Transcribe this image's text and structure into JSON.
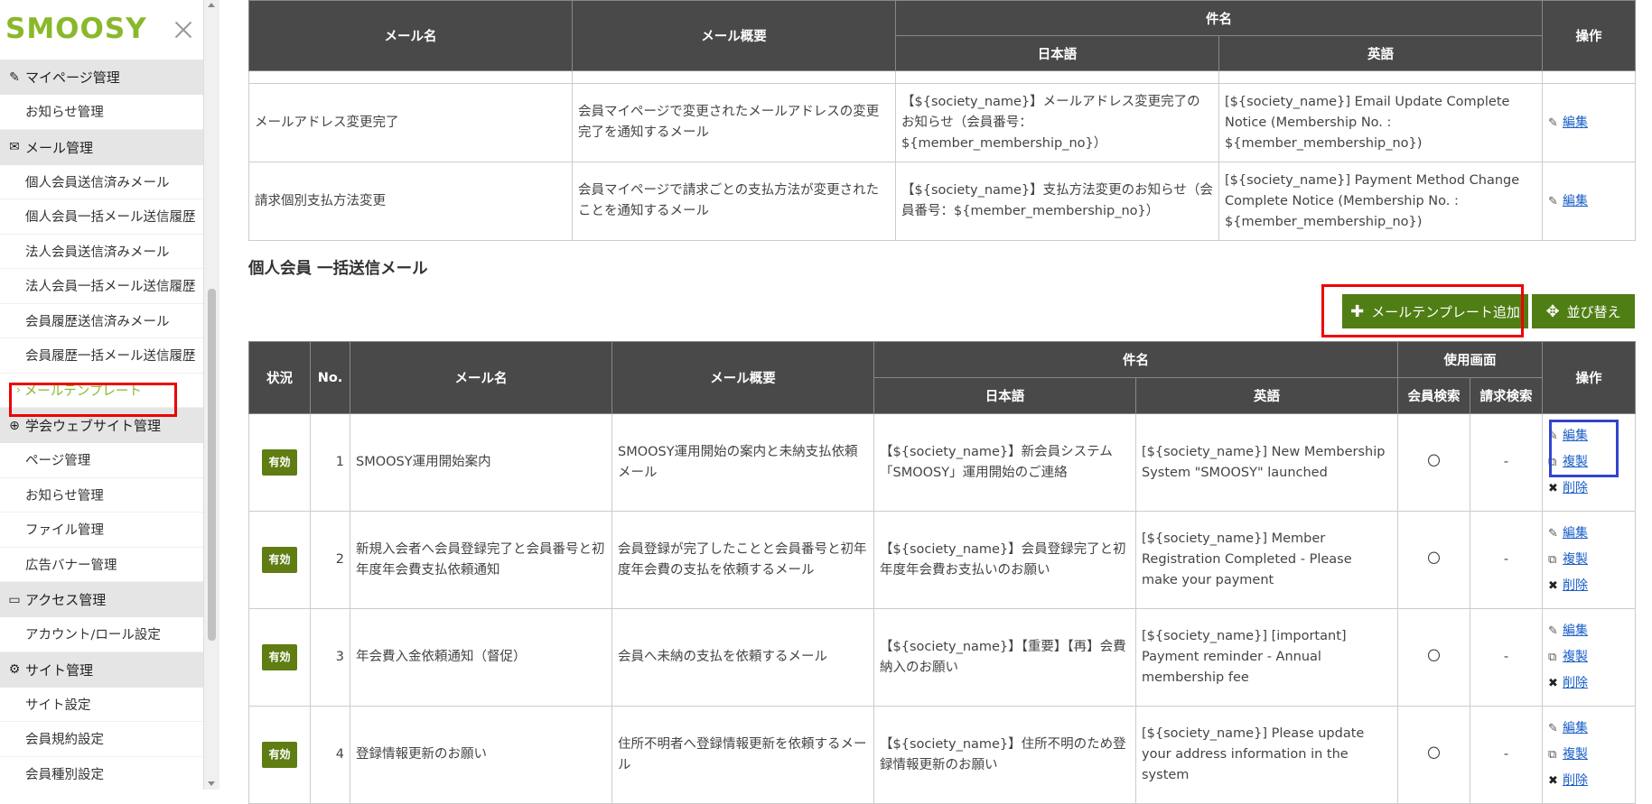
{
  "sidebar": {
    "logo": "SMOOSY",
    "groups": [
      {
        "icon": "pencil-icon",
        "label": "マイページ管理",
        "items": [
          "お知らせ管理"
        ]
      },
      {
        "icon": "mail-icon",
        "label": "メール管理",
        "items": [
          "個人会員送信済みメール",
          "個人会員一括メール送信履歴",
          "法人会員送信済みメール",
          "法人会員一括メール送信履歴",
          "会員履歴送信済みメール",
          "会員履歴一括メール送信履歴",
          "メールテンプレート"
        ]
      },
      {
        "icon": "globe-icon",
        "label": "学会ウェブサイト管理",
        "items": [
          "ページ管理",
          "お知らせ管理",
          "ファイル管理",
          "広告バナー管理"
        ]
      },
      {
        "icon": "monitor-icon",
        "label": "アクセス管理",
        "items": [
          "アカウント/ロール設定"
        ]
      },
      {
        "icon": "gear-icon",
        "label": "サイト管理",
        "items": [
          "サイト設定",
          "会員規約設定",
          "会員種別設定"
        ]
      }
    ]
  },
  "table1": {
    "headers": {
      "mail_name": "メール名",
      "summary": "メール概要",
      "subject": "件名",
      "ja": "日本語",
      "en": "英語",
      "ops": "操作"
    },
    "rows": [
      {
        "name": "メールアドレス変更完了",
        "summary": "会員マイページで変更されたメールアドレスの変更完了を通知するメール",
        "ja": "【${society_name}】メールアドレス変更完了のお知らせ（会員番号：${member_membership_no}）",
        "en": "[${society_name}] Email Update Complete Notice (Membership No. : ${member_membership_no})",
        "edit": "編集"
      },
      {
        "name": "請求個別支払方法変更",
        "summary": "会員マイページで請求ごとの支払方法が変更されたことを通知するメール",
        "ja": "【${society_name}】支払方法変更のお知らせ（会員番号：${member_membership_no}）",
        "en": "[${society_name}] Payment Method Change Complete Notice (Membership No. : ${member_membership_no})",
        "edit": "編集"
      }
    ]
  },
  "section2": {
    "title": "個人会員 一括送信メール",
    "add_button": "メールテンプレート追加",
    "sort_button": "並び替え"
  },
  "table2": {
    "headers": {
      "status": "状況",
      "no": "No.",
      "mail_name": "メール名",
      "summary": "メール概要",
      "subject": "件名",
      "ja": "日本語",
      "en": "英語",
      "screen": "使用画面",
      "member_search": "会員検索",
      "billing_search": "請求検索",
      "ops": "操作"
    },
    "rows": [
      {
        "status": "有効",
        "no": "1",
        "name": "SMOOSY運用開始案内",
        "summary": "SMOOSY運用開始の案内と未納支払依頼メール",
        "ja": "【${society_name}】新会員システム「SMOOSY」運用開始のご連絡",
        "en": "[${society_name}] New Membership System \"SMOOSY\" launched",
        "member": "〇",
        "billing": "-",
        "edit": "編集",
        "copy": "複製",
        "delete": "削除"
      },
      {
        "status": "有効",
        "no": "2",
        "name": "新規入会者へ会員登録完了と会員番号と初年度年会費支払依頼通知",
        "summary": "会員登録が完了したことと会員番号と初年度年会費の支払を依頼するメール",
        "ja": "【${society_name}】会員登録完了と初年度年会費お支払いのお願い",
        "en": "[${society_name}] Member Registration Completed - Please make your payment",
        "member": "〇",
        "billing": "-",
        "edit": "編集",
        "copy": "複製",
        "delete": "削除"
      },
      {
        "status": "有効",
        "no": "3",
        "name": "年会費入金依頼通知（督促）",
        "summary": "会員へ未納の支払を依頼するメール",
        "ja": "【${society_name}】【重要】【再】会費納入のお願い",
        "en": "[${society_name}] [important] Payment reminder - Annual membership fee",
        "member": "〇",
        "billing": "-",
        "edit": "編集",
        "copy": "複製",
        "delete": "削除"
      },
      {
        "status": "有効",
        "no": "4",
        "name": "登録情報更新のお願い",
        "summary": "住所不明者へ登録情報更新を依頼するメール",
        "ja": "【${society_name}】住所不明のため登録情報更新のお願い",
        "en": "[${society_name}] Please update your address information in the system",
        "member": "〇",
        "billing": "-",
        "edit": "編集",
        "copy": "複製",
        "delete": "削除"
      }
    ]
  },
  "colors": {
    "accent": "#8ab82a",
    "button": "#4f7e14",
    "header": "#494949",
    "badge": "#5f7d12",
    "highlight_red": "#ee0000",
    "highlight_blue": "#3344cc"
  }
}
